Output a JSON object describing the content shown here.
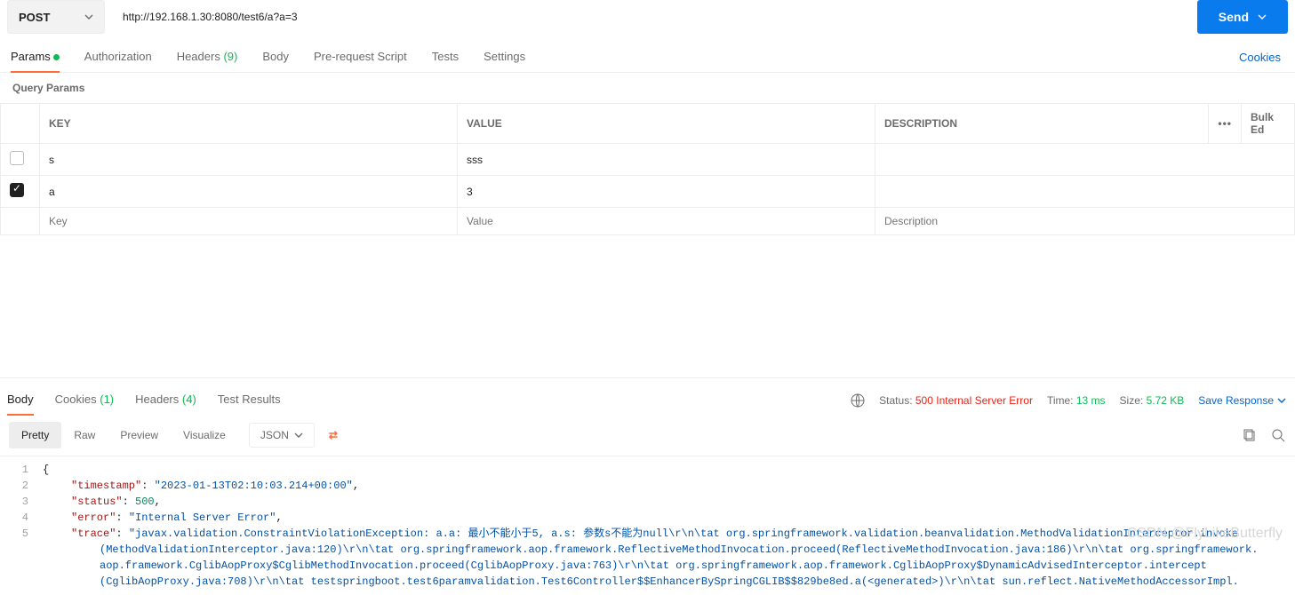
{
  "request": {
    "method": "POST",
    "url": "http://192.168.1.30:8080/test6/a?a=3",
    "send_label": "Send"
  },
  "tabs": {
    "params": "Params",
    "authorization": "Authorization",
    "headers_label": "Headers",
    "headers_count": "(9)",
    "body": "Body",
    "prerequest": "Pre-request Script",
    "tests": "Tests",
    "settings": "Settings",
    "cookies_link": "Cookies"
  },
  "params_section": {
    "title": "Query Params",
    "headers": {
      "key": "KEY",
      "value": "VALUE",
      "description": "DESCRIPTION",
      "bulk": "Bulk Ed"
    },
    "rows": [
      {
        "checked": false,
        "key": "s",
        "value": "sss",
        "description": ""
      },
      {
        "checked": true,
        "key": "a",
        "value": "3",
        "description": ""
      }
    ],
    "placeholder": {
      "key": "Key",
      "value": "Value",
      "description": "Description"
    }
  },
  "response": {
    "tabs": {
      "body": "Body",
      "cookies_label": "Cookies",
      "cookies_count": "(1)",
      "headers_label": "Headers",
      "headers_count": "(4)",
      "tests": "Test Results"
    },
    "meta": {
      "status_label": "Status:",
      "status_value": "500 Internal Server Error",
      "time_label": "Time:",
      "time_value": "13 ms",
      "size_label": "Size:",
      "size_value": "5.72 KB",
      "save_label": "Save Response"
    },
    "view": {
      "pretty": "Pretty",
      "raw": "Raw",
      "preview": "Preview",
      "visualize": "Visualize",
      "format": "JSON"
    },
    "json": {
      "line1": "{",
      "line2_key": "\"timestamp\"",
      "line2_val": "\"2023-01-13T02:10:03.214+00:00\"",
      "line3_key": "\"status\"",
      "line3_val": "500",
      "line4_key": "\"error\"",
      "line4_val": "\"Internal Server Error\"",
      "line5_key": "\"trace\"",
      "line5_val_a": "\"javax.validation.ConstraintViolationException: a.a: 最小不能小于5, a.s: 参数s不能为null\\r\\n\\tat org.springframework.validation.beanvalidation.MethodValidationInterceptor.invoke",
      "line5_val_b": "(MethodValidationInterceptor.java:120)\\r\\n\\tat org.springframework.aop.framework.ReflectiveMethodInvocation.proceed(ReflectiveMethodInvocation.java:186)\\r\\n\\tat org.springframework.",
      "line5_val_c": "aop.framework.CglibAopProxy$CglibMethodInvocation.proceed(CglibAopProxy.java:763)\\r\\n\\tat org.springframework.aop.framework.CglibAopProxy$DynamicAdvisedInterceptor.intercept",
      "line5_val_d": "(CglibAopProxy.java:708)\\r\\n\\tat testspringboot.test6paramvalidation.Test6Controller$$EnhancerBySpringCGLIB$$829be8ed.a(<generated>)\\r\\n\\tat sun.reflect.NativeMethodAccessorImpl."
    }
  },
  "watermark": "CSDN @FlyLikeButterfly"
}
